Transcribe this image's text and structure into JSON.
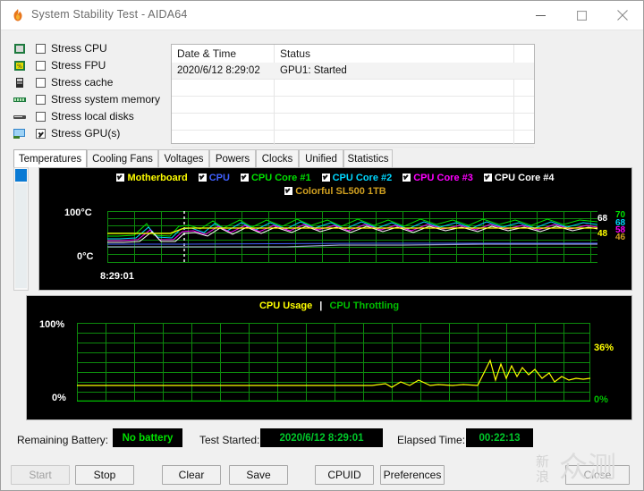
{
  "window": {
    "title": "System Stability Test - AIDA64",
    "app_icon": "flame-icon",
    "controls": {
      "minimize": "−",
      "maximize": "□",
      "close": "✕"
    }
  },
  "stress_options": [
    {
      "label": "Stress CPU",
      "checked": false,
      "icon": "cpu-chip-icon"
    },
    {
      "label": "Stress FPU",
      "checked": false,
      "icon": "fpu-chip-icon"
    },
    {
      "label": "Stress cache",
      "checked": false,
      "icon": "cache-icon"
    },
    {
      "label": "Stress system memory",
      "checked": false,
      "icon": "memory-module-icon"
    },
    {
      "label": "Stress local disks",
      "checked": false,
      "icon": "hard-disk-icon"
    },
    {
      "label": "Stress GPU(s)",
      "checked": true,
      "icon": "monitor-gpu-icon"
    }
  ],
  "log": {
    "columns": [
      "Date & Time",
      "Status"
    ],
    "rows": [
      {
        "datetime": "2020/6/12 8:29:02",
        "status": "GPU1: Started"
      },
      {
        "datetime": "",
        "status": ""
      },
      {
        "datetime": "",
        "status": ""
      },
      {
        "datetime": "",
        "status": ""
      },
      {
        "datetime": "",
        "status": ""
      }
    ]
  },
  "tabs": [
    {
      "label": "Temperatures",
      "active": true
    },
    {
      "label": "Cooling Fans",
      "active": false
    },
    {
      "label": "Voltages",
      "active": false
    },
    {
      "label": "Powers",
      "active": false
    },
    {
      "label": "Clocks",
      "active": false
    },
    {
      "label": "Unified",
      "active": false
    },
    {
      "label": "Statistics",
      "active": false
    }
  ],
  "temperature_chart": {
    "legend": [
      {
        "label": "Motherboard",
        "color": "#ffff00",
        "checked": true
      },
      {
        "label": "CPU",
        "color": "#4060ff",
        "checked": true
      },
      {
        "label": "CPU Core #1",
        "color": "#00e000",
        "checked": true
      },
      {
        "label": "CPU Core #2",
        "color": "#00d8ff",
        "checked": true
      },
      {
        "label": "CPU Core #3",
        "color": "#ff00ff",
        "checked": true
      },
      {
        "label": "CPU Core #4",
        "color": "#ffffff",
        "checked": true
      },
      {
        "label": "Colorful SL500 1TB",
        "color": "#d0a020",
        "checked": true
      }
    ],
    "y_top_label": "100°C",
    "y_bottom_label": "0°C",
    "x_label": "8:29:01",
    "current_values": [
      {
        "value": "68",
        "color": "#ffffff"
      },
      {
        "value": "48",
        "color": "#ffff00"
      },
      {
        "value": "70",
        "color": "#00e000"
      },
      {
        "value": "68",
        "color": "#00d8ff"
      },
      {
        "value": "58",
        "color": "#ff00ff"
      },
      {
        "value": "46",
        "color": "#d0a020"
      }
    ]
  },
  "usage_chart": {
    "legend_usage": "CPU Usage",
    "legend_separator": "|",
    "legend_throttling": "CPU Throttling",
    "usage_color": "#ffff00",
    "throttling_color": "#00c000",
    "y_top_label": "100%",
    "y_bottom_label": "0%",
    "value_usage": "36%",
    "value_throttling": "0%"
  },
  "status": {
    "battery_label": "Remaining Battery:",
    "battery_value": "No battery",
    "battery_color": "#00e000",
    "started_label": "Test Started:",
    "started_value": "2020/6/12 8:29:01",
    "started_color": "#00c82a",
    "elapsed_label": "Elapsed Time:",
    "elapsed_value": "00:22:13",
    "elapsed_color": "#00c82a"
  },
  "buttons": [
    {
      "label": "Start",
      "disabled": true
    },
    {
      "label": "Stop",
      "disabled": false
    },
    {
      "label": "Clear",
      "disabled": false
    },
    {
      "label": "Save",
      "disabled": false
    },
    {
      "label": "CPUID",
      "disabled": false
    },
    {
      "label": "Preferences",
      "disabled": false
    },
    {
      "label": "Close",
      "disabled": false
    }
  ],
  "watermark": {
    "line1": "新",
    "line2": "浪",
    "big": "众测"
  }
}
